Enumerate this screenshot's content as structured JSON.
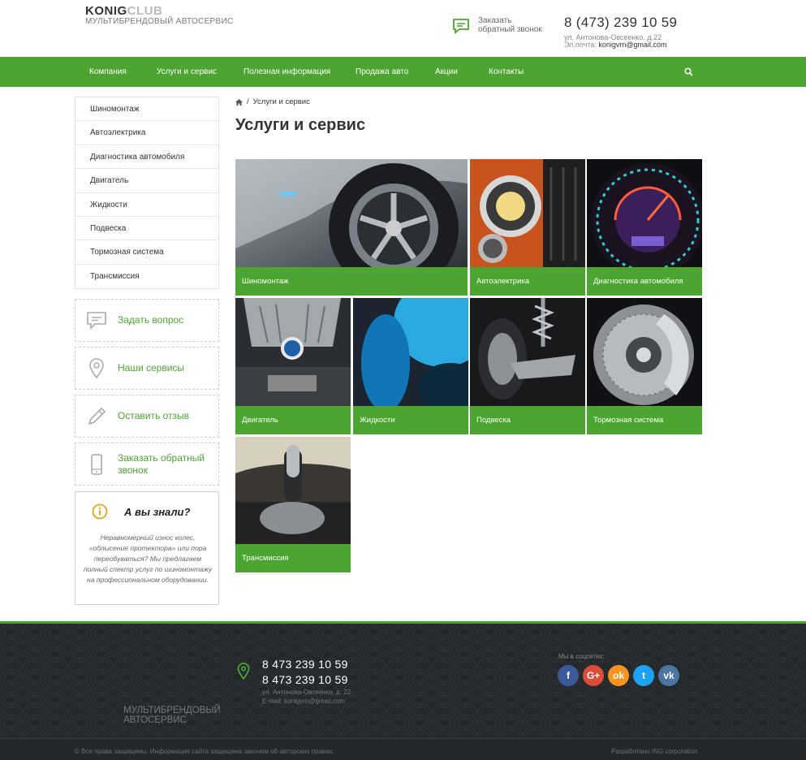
{
  "header": {
    "logo_main": "KONIG",
    "logo_accent": "CLUB",
    "logo_sub": "МУЛЬТИБРЕНДОВЫЙ АВТОСЕРВИС",
    "callback_label": "Заказать обратный звонок",
    "phone": "8 (473) 239 10 59",
    "address": "ул. Антонова-Овсеенко, д.22",
    "email_label": "Эл.почта:",
    "email": "konigvrn@gmail.com"
  },
  "nav": {
    "items": [
      "Компания",
      "Услуги и сервис",
      "Полезная информация",
      "Продажа авто",
      "Акции",
      "Контакты"
    ],
    "search_icon": "search-icon"
  },
  "sidebar": {
    "menu": [
      "Шиномонтаж",
      "Автоэлектрика",
      "Диагностика автомобиля",
      "Двигатель",
      "Жидкости",
      "Подвеска",
      "Тормозная система",
      "Трансмиссия"
    ],
    "actions": [
      {
        "label": "Задать вопрос",
        "icon": "chat-icon"
      },
      {
        "label": "Наши сервисы",
        "icon": "map-pin-icon"
      },
      {
        "label": "Оставить отзыв",
        "icon": "pencil-icon"
      },
      {
        "label": "Заказать обратный звонок",
        "icon": "phone-icon"
      }
    ],
    "did_you_know": {
      "title": "А вы знали?",
      "icon": "info-icon",
      "text": "Неравномерный износ колес, «облысение протектора» или пора переобуваться? Мы предлагаем полный спектр услуг по шиномонтажу на профессиональном оборудовании."
    }
  },
  "main": {
    "breadcrumb_home_icon": "home-icon",
    "breadcrumb_sep": "/",
    "breadcrumb_current": "Услуги и сервис",
    "title": "Услуги и сервис",
    "tiles": [
      "Шиномонтаж",
      "Автоэлектрика",
      "Диагностика автомобиля",
      "Двигатель",
      "Жидкости",
      "Подвеска",
      "Тормозная система",
      "Трансмиссия"
    ]
  },
  "footer": {
    "phone1": "8 473 239 10 59",
    "phone2": "8 473 239 10 59",
    "address": "ул. Антонова-Овсеенко, д. 22",
    "email": "E-mail: konigvrn@gmail.com",
    "sub_logo": "МУЛЬТИБРЕНДОВЫЙ АВТОСЕРВИС",
    "social_title": "Мы в соцсетях:",
    "social": [
      {
        "label": "f",
        "color": "#3b5998",
        "icon": "facebook-icon"
      },
      {
        "label": "G+",
        "color": "#dd4b39",
        "icon": "google-plus-icon"
      },
      {
        "label": "ok",
        "color": "#f7931e",
        "icon": "odnoklassniki-icon"
      },
      {
        "label": "t",
        "color": "#1da1f2",
        "icon": "twitter-icon"
      },
      {
        "label": "vk",
        "color": "#4c75a3",
        "icon": "vk-icon"
      }
    ],
    "copyright": "© Все права защищены. Информация сайта защищена законом об авторских правах.",
    "developer": "Разработано ING corporation"
  },
  "colors": {
    "accent": "#4ca530",
    "footer_bg": "#25282b"
  }
}
